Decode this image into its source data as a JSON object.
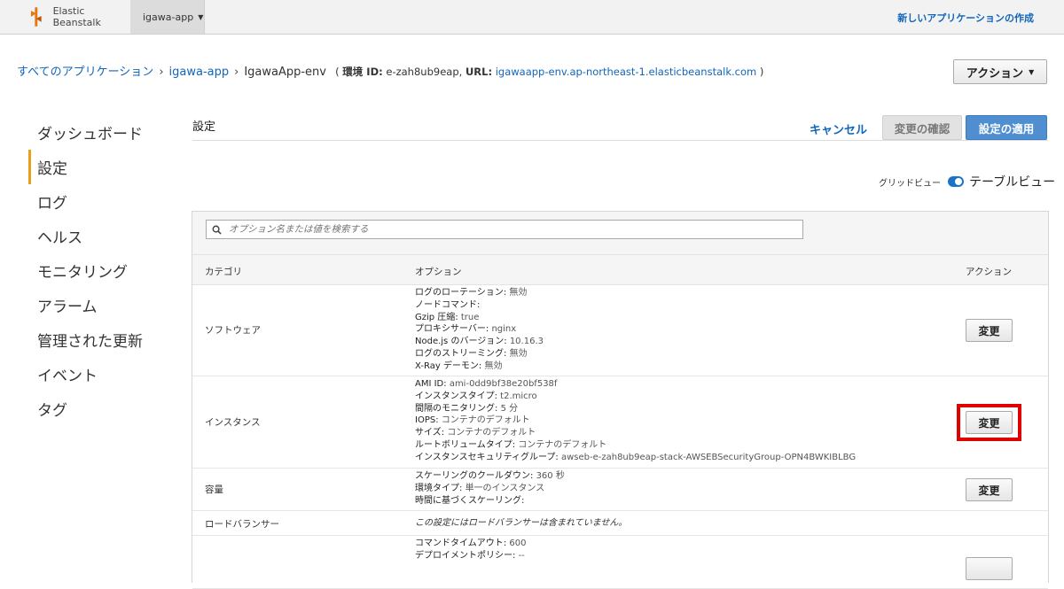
{
  "header": {
    "brand": "Elastic Beanstalk",
    "app_selector": "igawa-app",
    "new_app_link": "新しいアプリケーションの作成"
  },
  "breadcrumb": {
    "all_apps": "すべてのアプリケーション",
    "app": "igawa-app",
    "env": "IgawaApp-env",
    "env_id_label": "環境 ID:",
    "env_id": "e-zah8ub9eap",
    "url_label": "URL:",
    "url": "igawaapp-env.ap-northeast-1.elasticbeanstalk.com"
  },
  "action_button": "アクション",
  "sidebar": {
    "items": [
      {
        "label": "ダッシュボード"
      },
      {
        "label": "設定"
      },
      {
        "label": "ログ"
      },
      {
        "label": "ヘルス"
      },
      {
        "label": "モニタリング"
      },
      {
        "label": "アラーム"
      },
      {
        "label": "管理された更新"
      },
      {
        "label": "イベント"
      },
      {
        "label": "タグ"
      }
    ],
    "active_index": 1
  },
  "main": {
    "title": "設定",
    "cancel": "キャンセル",
    "confirm": "変更の確認",
    "apply": "設定の適用",
    "view_grid": "グリッドビュー",
    "view_table": "テーブルビュー",
    "search_placeholder": "オプション名または値を検索する",
    "columns": {
      "category": "カテゴリ",
      "options": "オプション",
      "action": "アクション"
    },
    "change_label": "変更",
    "rows": [
      {
        "category": "ソフトウェア",
        "options": [
          {
            "k": "ログのローテーション",
            "v": "無効"
          },
          {
            "k": "ノードコマンド",
            "v": ""
          },
          {
            "k": "Gzip 圧縮",
            "v": "true"
          },
          {
            "k": "プロキシサーバー",
            "v": "nginx"
          },
          {
            "k": "Node.js のバージョン",
            "v": "10.16.3"
          },
          {
            "k": "ログのストリーミング",
            "v": "無効"
          },
          {
            "k": "X-Ray デーモン",
            "v": "無効"
          }
        ]
      },
      {
        "category": "インスタンス",
        "options": [
          {
            "k": "AMI ID",
            "v": "ami-0dd9bf38e20bf538f"
          },
          {
            "k": "インスタンスタイプ",
            "v": "t2.micro"
          },
          {
            "k": "間隔のモニタリング",
            "v": "5 分"
          },
          {
            "k": "IOPS",
            "v": "コンテナのデフォルト"
          },
          {
            "k": "サイズ",
            "v": "コンテナのデフォルト"
          },
          {
            "k": "ルートボリュームタイプ",
            "v": "コンテナのデフォルト"
          },
          {
            "k": "インスタンスセキュリティグループ",
            "v": "awseb-e-zah8ub9eap-stack-AWSEBSecurityGroup-OPN4BWKIBLBG"
          }
        ]
      },
      {
        "category": "容量",
        "options": [
          {
            "k": "スケーリングのクールダウン",
            "v": "360 秒"
          },
          {
            "k": "環境タイプ",
            "v": "単一のインスタンス"
          },
          {
            "k": "時間に基づくスケーリング",
            "v": ""
          }
        ]
      },
      {
        "category": "ロードバランサー",
        "note": "この設定にはロードバランサーは含まれていません。"
      },
      {
        "category": "",
        "options": [
          {
            "k": "コマンドタイムアウト",
            "v": "600"
          },
          {
            "k": "デプロイメントポリシー",
            "v": "--"
          }
        ]
      }
    ]
  },
  "colors": {
    "accent": "#e6a01a",
    "link": "#1166bb",
    "primary": "#4f8ed0",
    "highlight": "#e00000"
  }
}
